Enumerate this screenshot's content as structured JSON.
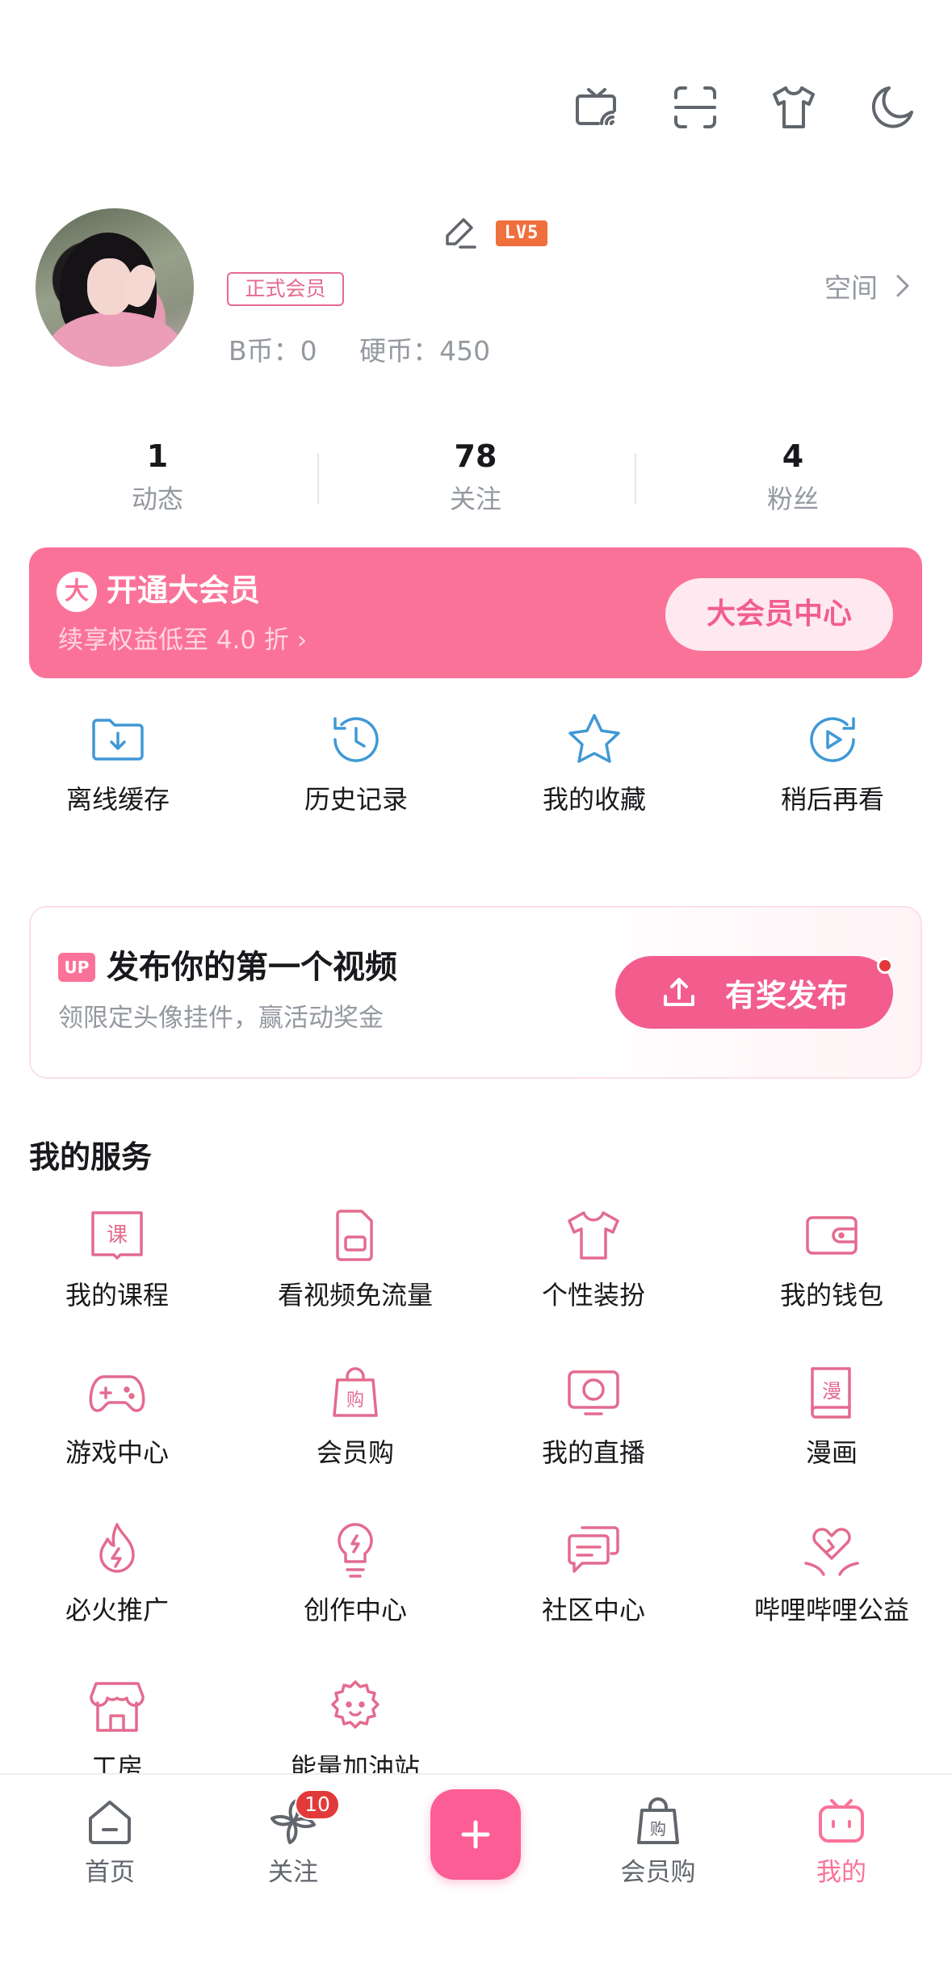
{
  "profile": {
    "level_badge": "LV5",
    "member_tag": "正式会员",
    "coins_text": "B币：0     硬币：450",
    "space_label": "空间"
  },
  "stats": [
    {
      "value": "1",
      "label": "动态"
    },
    {
      "value": "78",
      "label": "关注"
    },
    {
      "value": "4",
      "label": "粉丝"
    }
  ],
  "vip": {
    "logo": "大",
    "title": "开通大会员",
    "subtitle": "续享权益低至 4.0 折 ›",
    "button": "大会员中心"
  },
  "quick_actions": [
    {
      "label": "离线缓存",
      "icon": "download-folder-icon"
    },
    {
      "label": "历史记录",
      "icon": "history-clock-icon"
    },
    {
      "label": "我的收藏",
      "icon": "star-icon"
    },
    {
      "label": "稍后再看",
      "icon": "watch-later-icon"
    }
  ],
  "upload_card": {
    "tag": "UP",
    "title": "发布你的第一个视频",
    "subtitle": "领限定头像挂件，赢活动奖金",
    "button": "有奖发布"
  },
  "services": {
    "title": "我的服务",
    "items": [
      {
        "label": "我的课程",
        "icon": "course-book-icon"
      },
      {
        "label": "看视频免流量",
        "icon": "sim-card-icon"
      },
      {
        "label": "个性装扮",
        "icon": "tshirt-icon"
      },
      {
        "label": "我的钱包",
        "icon": "wallet-icon"
      },
      {
        "label": "游戏中心",
        "icon": "gamepad-icon"
      },
      {
        "label": "会员购",
        "icon": "shopping-bag-icon"
      },
      {
        "label": "我的直播",
        "icon": "live-tv-icon"
      },
      {
        "label": "漫画",
        "icon": "comic-book-icon"
      },
      {
        "label": "必火推广",
        "icon": "fire-icon"
      },
      {
        "label": "创作中心",
        "icon": "lightbulb-icon"
      },
      {
        "label": "社区中心",
        "icon": "chat-bubbles-icon"
      },
      {
        "label": "哔哩哔哩公益",
        "icon": "heart-hands-icon"
      },
      {
        "label": "工房",
        "icon": "shop-icon"
      },
      {
        "label": "能量加油站",
        "icon": "energy-flower-icon"
      }
    ]
  },
  "bottom_nav": {
    "items": [
      {
        "label": "首页",
        "icon": "home-icon"
      },
      {
        "label": "关注",
        "icon": "pinwheel-icon",
        "badge": "10"
      },
      {
        "label": "会员购",
        "icon": "shopping-bag-icon"
      },
      {
        "label": "我的",
        "icon": "tv-mascot-icon"
      }
    ]
  },
  "colors": {
    "brand_pink": "#fb7299",
    "accent_pink": "#f25d8e",
    "icon_blue": "#4098d6",
    "icon_pink": "#e46b8f",
    "gray_text": "#9499a0"
  }
}
